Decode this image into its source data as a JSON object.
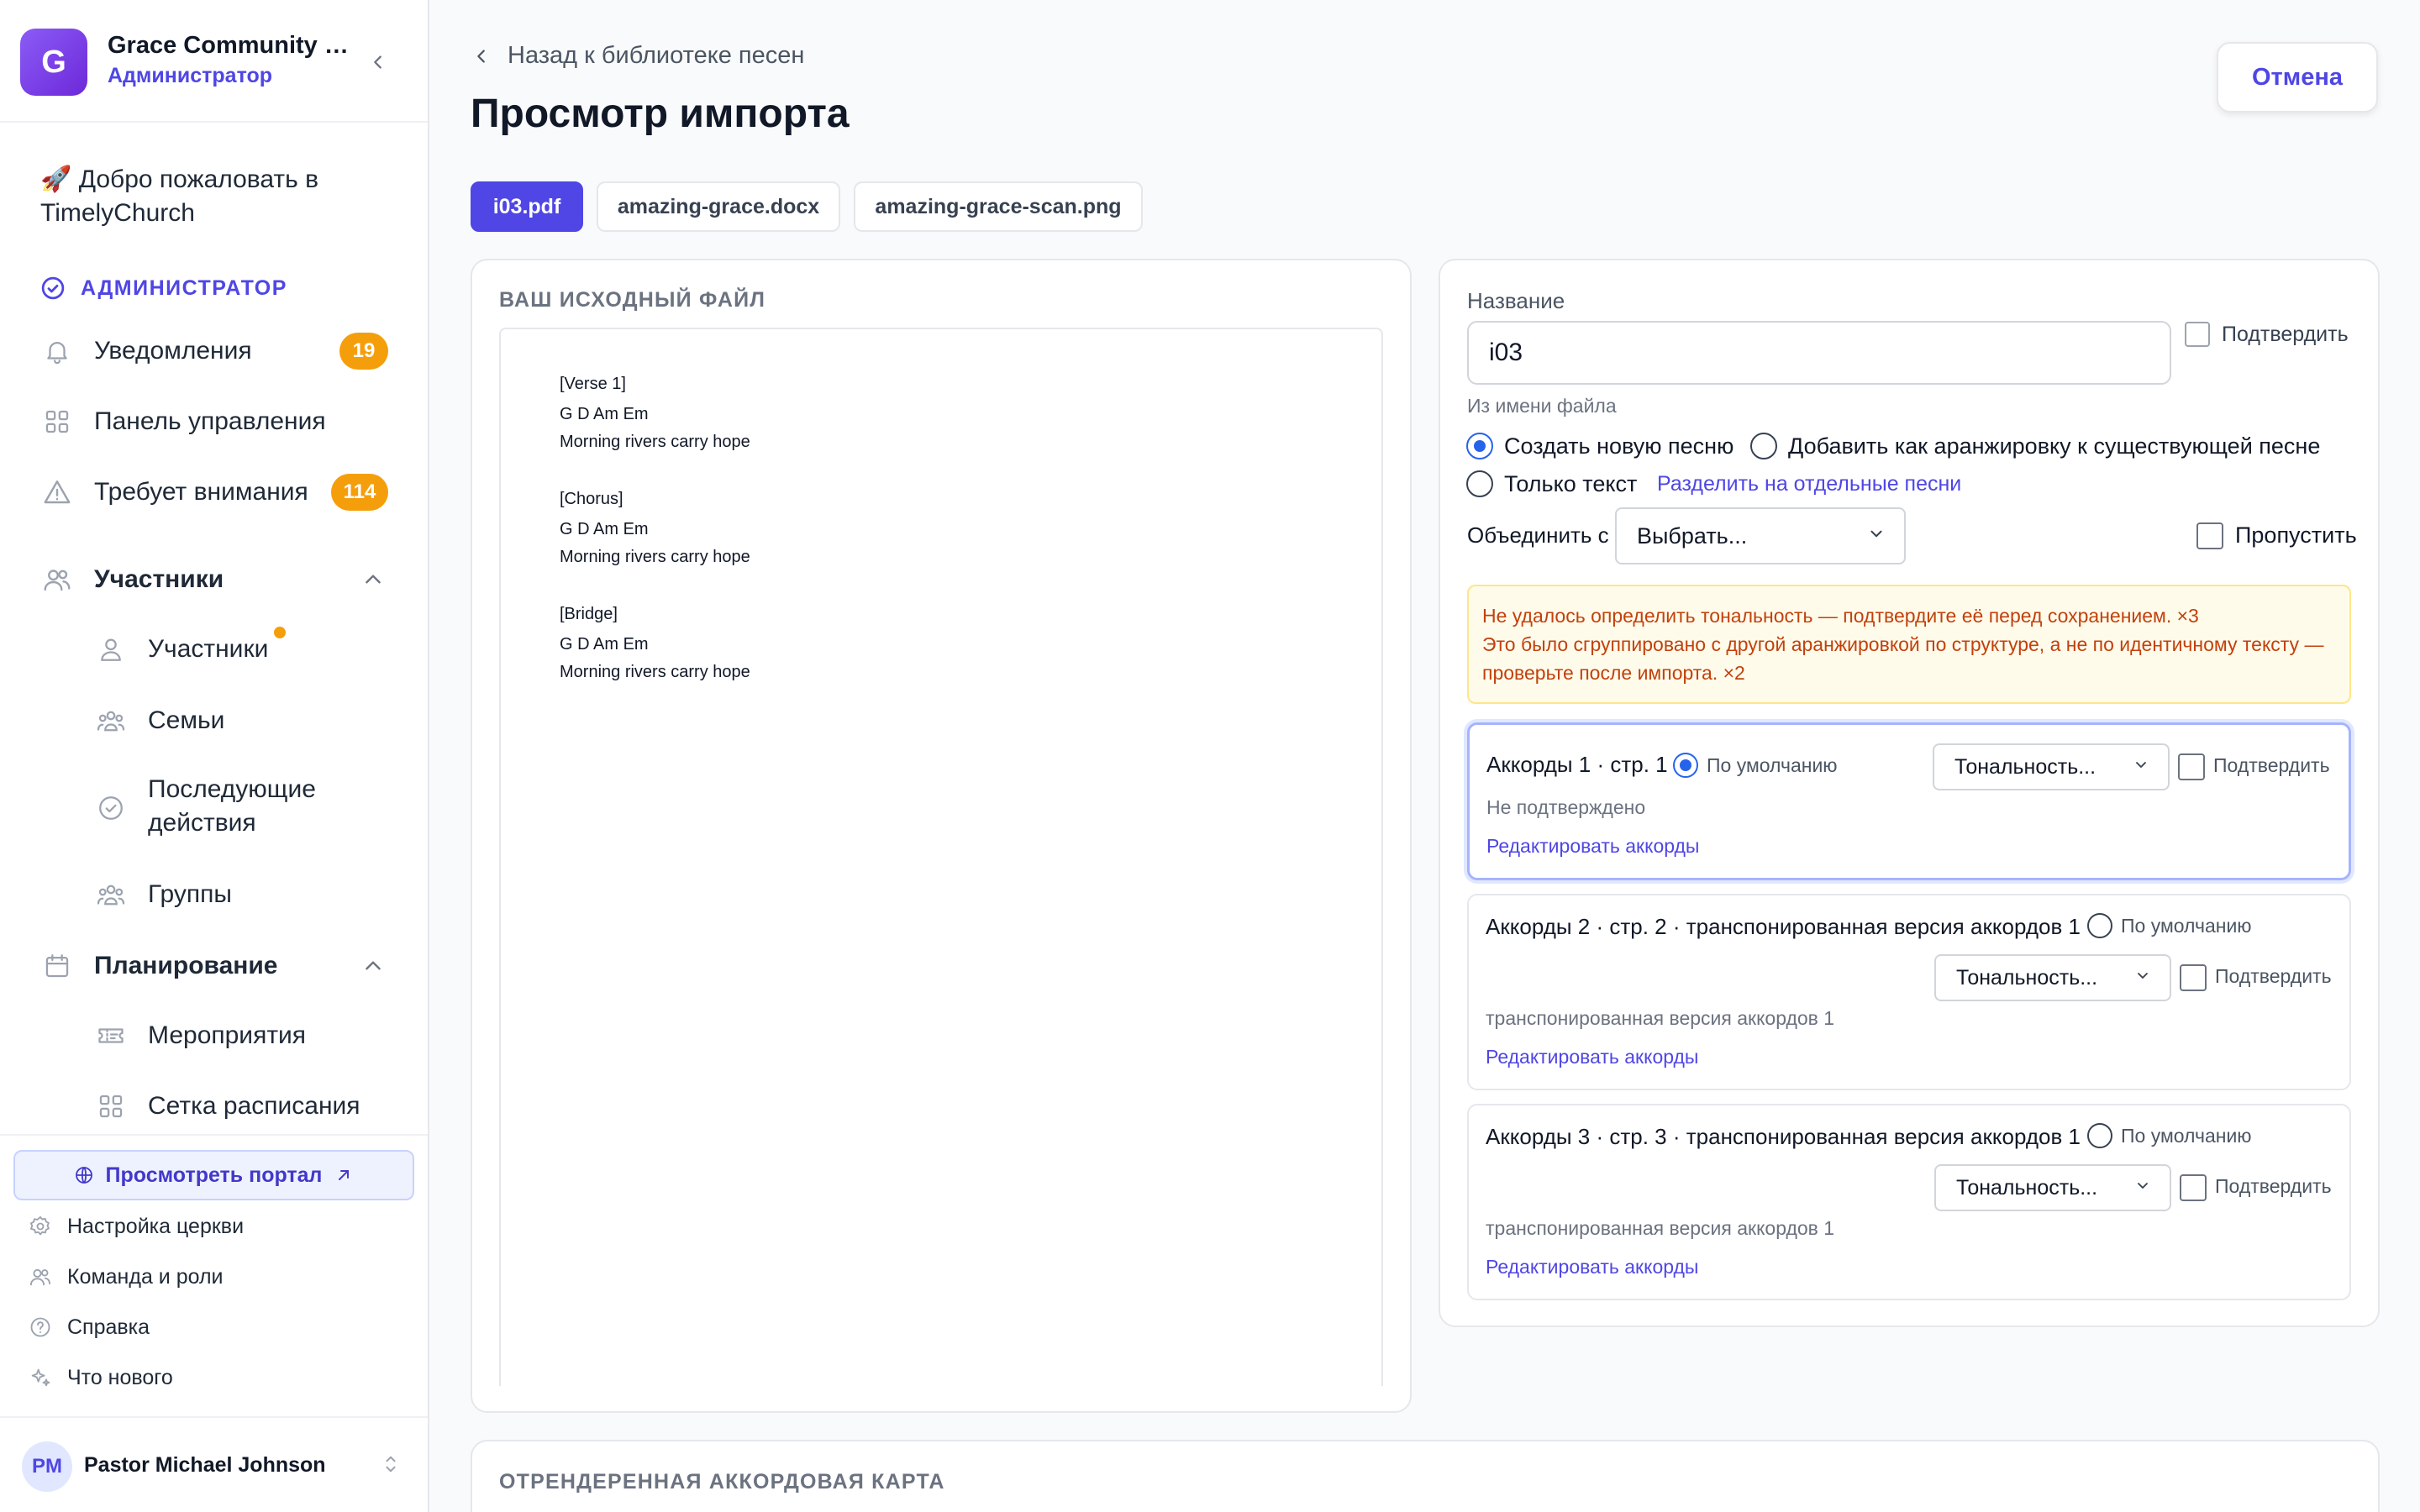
{
  "sidebar": {
    "org_initial": "G",
    "org_name": "Grace Community Church",
    "org_role": "Администратор",
    "welcome": "🚀 Добро пожаловать в TimelyChurch",
    "section_admin": "АДМИНИСТРАТОР",
    "nav": {
      "notifications": {
        "label": "Уведомления",
        "badge": "19"
      },
      "dashboard": {
        "label": "Панель управления"
      },
      "attention": {
        "label": "Требует внимания",
        "badge": "114"
      },
      "people_group": {
        "label": "Участники"
      },
      "people": {
        "label": "Участники"
      },
      "families": {
        "label": "Семьи"
      },
      "followups": {
        "label": "Последующие действия"
      },
      "groups": {
        "label": "Группы"
      },
      "planning_group": {
        "label": "Планирование"
      },
      "events": {
        "label": "Мероприятия"
      },
      "schedule": {
        "label": "Сетка расписания"
      }
    },
    "portal_button": "Просмотреть портал",
    "footer": {
      "church_settings": "Настройка церкви",
      "team_roles": "Команда и роли",
      "help": "Справка",
      "whats_new": "Что нового"
    },
    "user": {
      "initials": "PM",
      "name": "Pastor Michael Johnson"
    }
  },
  "header": {
    "back_link": "Назад к библиотеке песен",
    "title": "Просмотр импорта",
    "cancel": "Отмена"
  },
  "file_tabs": [
    "i03.pdf",
    "amazing-grace.docx",
    "amazing-grace-scan.png"
  ],
  "source_panel": {
    "heading": "ВАШ ИСХОДНЫЙ ФАЙЛ",
    "lines": [
      "[Verse 1]",
      "G D Am Em",
      "Morning rivers carry hope",
      "[Chorus]",
      "G D Am Em",
      "Morning rivers carry hope",
      "[Bridge]",
      "G D Am Em",
      "Morning rivers carry hope"
    ]
  },
  "form": {
    "name_label": "Название",
    "name_value": "i03",
    "confirm_label": "Подтвердить",
    "name_hint": "Из имени файла",
    "radio_new": "Создать новую песню",
    "radio_arrangement": "Добавить как аранжировку к существующей песне",
    "radio_text_only": "Только текст",
    "split_link": "Разделить на отдельные песни",
    "merge_label": "Объединить с",
    "merge_select": "Выбрать...",
    "skip_label": "Пропустить",
    "alert_line1": "Не удалось определить тональность — подтвердите её перед сохранением. ×3",
    "alert_line2": "Это было сгруппировано с другой аранжировкой по структуре, а не по идентичному тексту — проверьте после импорта. ×2"
  },
  "chord_cards": [
    {
      "title": "Аккорды 1 · стр. 1",
      "default_label": "По умолчанию",
      "key_select": "Тональность...",
      "confirm_label": "Подтвердить",
      "status": "Не подтверждено",
      "edit_link": "Редактировать аккорды"
    },
    {
      "title": "Аккорды 2 · стр. 2 · транспонированная версия аккордов 1",
      "default_label": "По умолчанию",
      "key_select": "Тональность...",
      "confirm_label": "Подтвердить",
      "status": "транспонированная версия аккордов 1",
      "edit_link": "Редактировать аккорды"
    },
    {
      "title": "Аккорды 3 · стр. 3 · транспонированная версия аккордов 1",
      "default_label": "По умолчанию",
      "key_select": "Тональность...",
      "confirm_label": "Подтвердить",
      "status": "транспонированная версия аккордов 1",
      "edit_link": "Редактировать аккорды"
    }
  ],
  "rendered_panel": {
    "heading": "ОТРЕНДЕРЕННАЯ АККОРДОВАЯ КАРТА"
  },
  "colors": {
    "accent": "#4f46e5",
    "badge": "#f59e0b",
    "alert_text": "#c2410c",
    "radio_on": "#2563eb"
  }
}
